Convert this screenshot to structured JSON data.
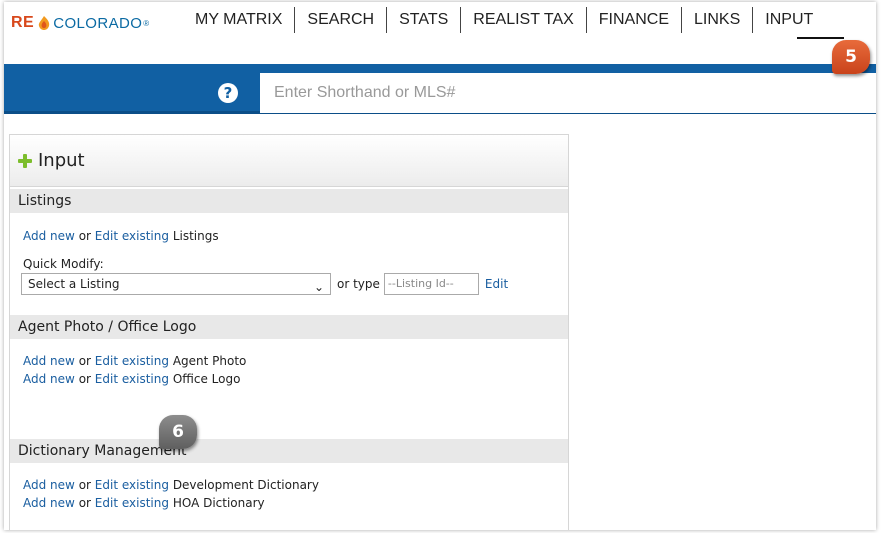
{
  "logo": {
    "re": "RE",
    "colorado": "COLORADO",
    "reg": "®"
  },
  "nav": {
    "items": [
      "MY MATRIX",
      "SEARCH",
      "STATS",
      "REALIST TAX",
      "FINANCE",
      "LINKS",
      "INPUT"
    ]
  },
  "search": {
    "help": "?",
    "placeholder": "Enter Shorthand or MLS#"
  },
  "callouts": {
    "five": "5",
    "six": "6"
  },
  "panel": {
    "title": "Input",
    "sections": {
      "listings": {
        "heading": "Listings",
        "add_new": "Add new",
        "or": "or",
        "edit_existing": "Edit existing",
        "target": "Listings",
        "quick_modify_label": "Quick Modify:",
        "select_value": "Select a Listing",
        "or_type": "or type",
        "id_placeholder": "--Listing Id--",
        "edit": "Edit"
      },
      "photo": {
        "heading": "Agent Photo / Office Logo",
        "rows": [
          {
            "add_new": "Add new",
            "or": "or",
            "edit_existing": "Edit existing",
            "target": "Agent Photo"
          },
          {
            "add_new": "Add new",
            "or": "or",
            "edit_existing": "Edit existing",
            "target": "Office Logo"
          }
        ]
      },
      "dictionary": {
        "heading": "Dictionary Management",
        "rows": [
          {
            "add_new": "Add new",
            "or": "or",
            "edit_existing": "Edit existing",
            "target": "Development Dictionary"
          },
          {
            "add_new": "Add new",
            "or": "or",
            "edit_existing": "Edit existing",
            "target": "HOA Dictionary"
          }
        ]
      }
    }
  },
  "colors": {
    "brand_blue": "#1160a3",
    "brand_orange": "#d8481c",
    "link": "#1a5ea0",
    "plus_green": "#7cbd2c"
  }
}
